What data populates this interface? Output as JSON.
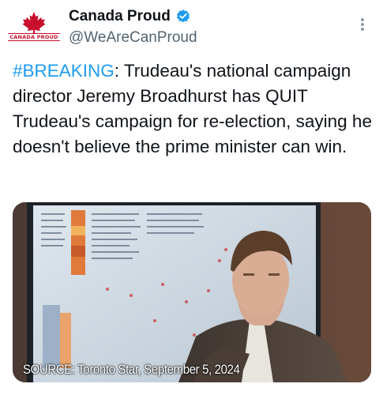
{
  "account": {
    "display_name": "Canada Proud",
    "handle": "@WeAreCanProud",
    "verified": true,
    "avatar_text": "CANADA PROUD",
    "avatar_icon": "maple-leaf-icon"
  },
  "tweet": {
    "hashtag": "#BREAKING",
    "body": ": Trudeau's national campaign director Jeremy Broadhurst has QUIT Trudeau's campaign for re-election, saying he doesn't believe the prime minister can win."
  },
  "media": {
    "caption": "SOURCE: Toronto Star, September 5, 2024",
    "description_icon": "photo"
  },
  "colors": {
    "link": "#1d9bf0",
    "verified": "#1d9bf0",
    "secondary_text": "#536471",
    "brand_red": "#c8102e"
  }
}
